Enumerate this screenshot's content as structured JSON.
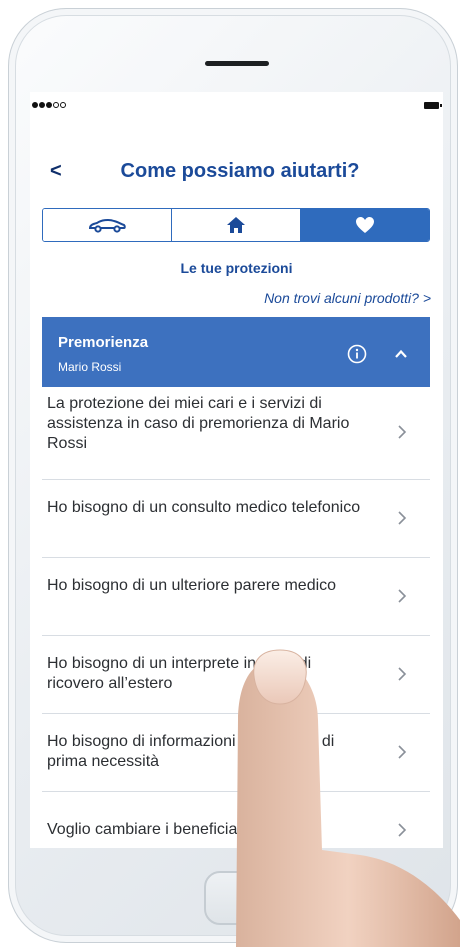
{
  "header": {
    "back_label": "<",
    "title": "Come possiamo aiutarti?"
  },
  "tabs": [
    {
      "icon": "car-icon",
      "active": false
    },
    {
      "icon": "home-icon",
      "active": false
    },
    {
      "icon": "heart-icon",
      "active": true
    }
  ],
  "section": {
    "title": "Le tue protezioni",
    "missing_products_link": "Non trovi alcuni prodotti? >"
  },
  "accordion": {
    "title": "Premorienza",
    "subtitle": "Mario Rossi",
    "items": [
      {
        "label": "La protezione dei miei cari e i servizi di assistenza in caso di premorienza di Mario Rossi"
      },
      {
        "label": "Ho bisogno di un consulto medico telefonico"
      },
      {
        "label": "Ho bisogno di un ulteriore parere medico"
      },
      {
        "label": "Ho bisogno di un interprete in caso di ricovero all’estero"
      },
      {
        "label": "Ho bisogno di informazioni telefoniche di prima necessità"
      },
      {
        "label": "Voglio cambiare i beneficiari"
      }
    ]
  },
  "colors": {
    "primary": "#3d71bf",
    "title": "#1b4a99",
    "text": "#2c2f33",
    "divider": "#d8dde3"
  }
}
